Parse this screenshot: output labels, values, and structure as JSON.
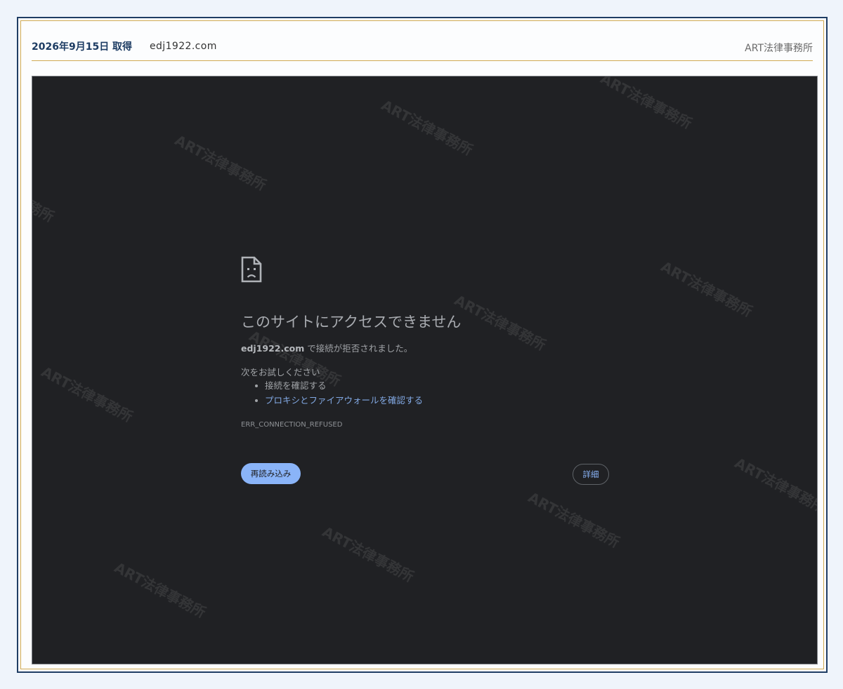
{
  "header": {
    "capture_date": "2026年9月15日 取得",
    "domain": "edj1922.com",
    "firm_name": "ART法律事務所"
  },
  "watermark": {
    "text": "ART法律事務所"
  },
  "error_page": {
    "icon": "sad-page-icon",
    "title": "このサイトにアクセスできません",
    "host": "edj1922.com",
    "description_suffix": " で接続が拒否されました。",
    "try_heading": "次をお試しください",
    "suggestions": [
      {
        "label": "接続を確認する",
        "is_link": false
      },
      {
        "label": "プロキシとファイアウォールを確認する",
        "is_link": true
      }
    ],
    "error_code": "ERR_CONNECTION_REFUSED",
    "reload_button": "再読み込み",
    "details_button": "詳細"
  },
  "colors": {
    "page_background": "#eff4fb",
    "frame_navy": "#1f3d64",
    "frame_gold": "#d1aa52",
    "error_background": "#202124",
    "accent_blue": "#8ab4f8"
  }
}
